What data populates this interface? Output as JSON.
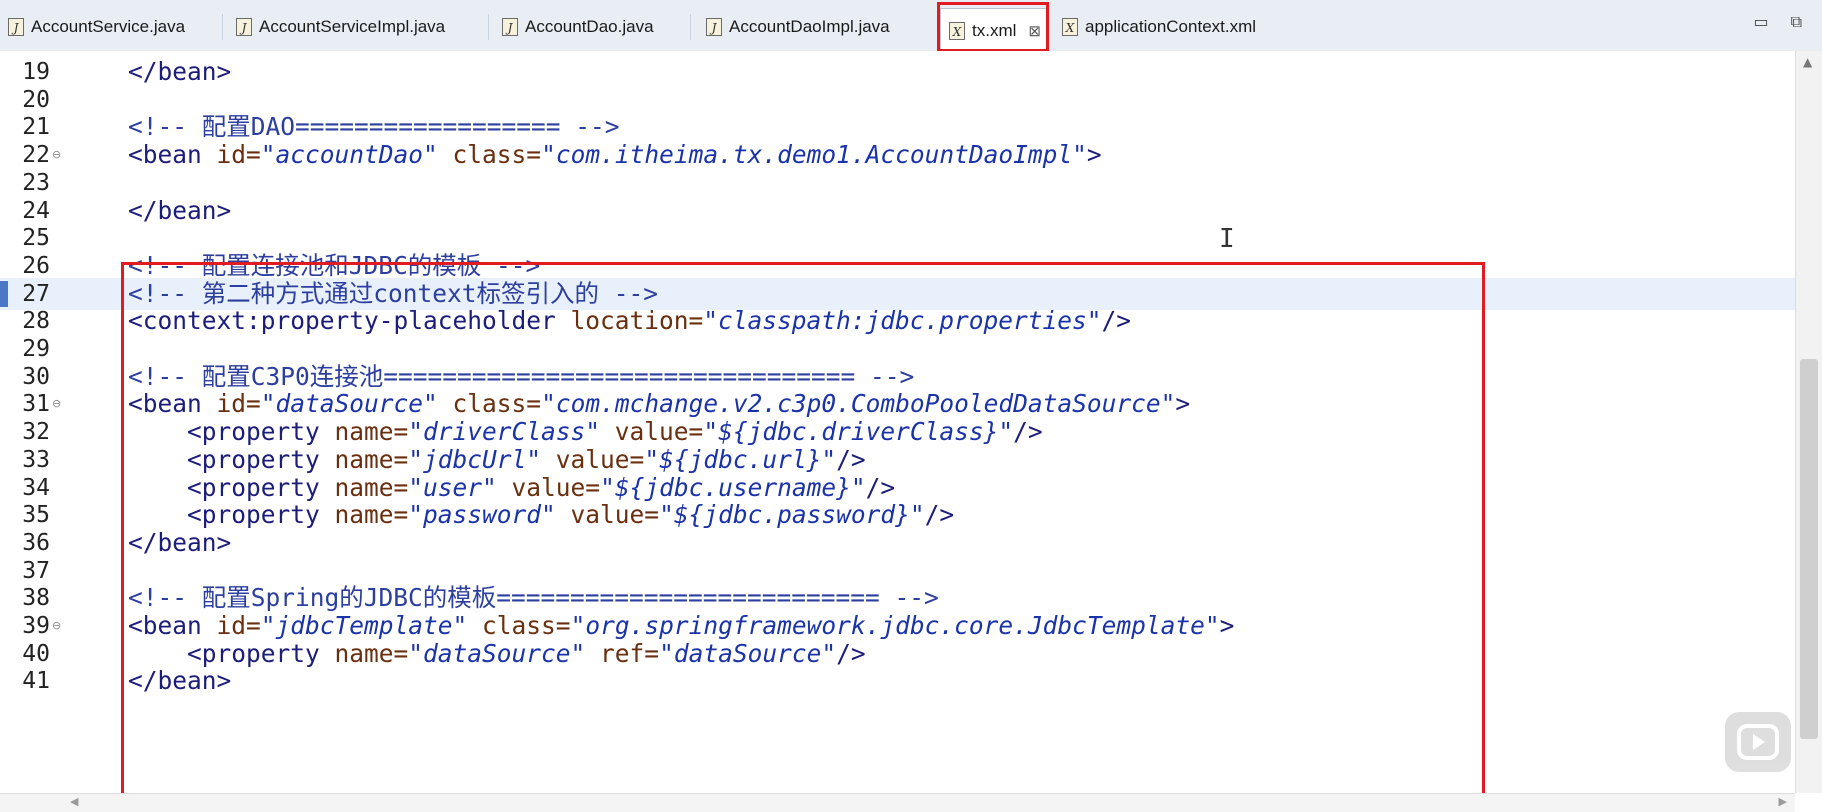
{
  "tabs": [
    {
      "label": "AccountService.java",
      "icon": "java-file-icon"
    },
    {
      "label": "AccountServiceImpl.java",
      "icon": "java-file-icon"
    },
    {
      "label": "AccountDao.java",
      "icon": "java-file-icon"
    },
    {
      "label": "AccountDaoImpl.java",
      "icon": "java-file-icon"
    },
    {
      "label": "tx.xml",
      "icon": "xml-file-icon",
      "active": true
    },
    {
      "label": "applicationContext.xml",
      "icon": "xml-file-icon"
    }
  ],
  "tab_close_glyph": "⊠",
  "window_controls": {
    "minimize": "▭",
    "maximize": "⧉"
  },
  "editor": {
    "current_line": 27,
    "lines": [
      {
        "n": "19",
        "parts": [
          [
            "tag",
            "</bean>"
          ]
        ]
      },
      {
        "n": "20",
        "parts": []
      },
      {
        "n": "21",
        "parts": [
          [
            "cmt",
            "<!-- 配置DAO================== -->"
          ]
        ]
      },
      {
        "n": "22",
        "fold": true,
        "parts": [
          [
            "tag",
            "<bean "
          ],
          [
            "attr",
            "id="
          ],
          [
            "str",
            "\"accountDao\""
          ],
          [
            "attr",
            " class="
          ],
          [
            "str",
            "\"com.itheima.tx.demo1.AccountDaoImpl\""
          ],
          [
            "tag",
            ">"
          ]
        ]
      },
      {
        "n": "23",
        "parts": []
      },
      {
        "n": "24",
        "parts": [
          [
            "tag",
            "</bean>"
          ]
        ]
      },
      {
        "n": "25",
        "parts": []
      },
      {
        "n": "26",
        "parts": [
          [
            "cmt",
            "<!-- 配置连接池和JDBC的模板 -->"
          ]
        ]
      },
      {
        "n": "27",
        "parts": [
          [
            "cmt",
            "<!-- 第二种方式通过context标签引入的 -->"
          ]
        ]
      },
      {
        "n": "28",
        "parts": [
          [
            "tag",
            "<context:property-placeholder "
          ],
          [
            "attr",
            "location="
          ],
          [
            "str",
            "\"classpath:jdbc.properties\""
          ],
          [
            "tag",
            "/>"
          ]
        ]
      },
      {
        "n": "29",
        "parts": []
      },
      {
        "n": "30",
        "parts": [
          [
            "cmt",
            "<!-- 配置C3P0连接池================================ -->"
          ]
        ]
      },
      {
        "n": "31",
        "fold": true,
        "parts": [
          [
            "tag",
            "<bean "
          ],
          [
            "attr",
            "id="
          ],
          [
            "str",
            "\"dataSource\""
          ],
          [
            "attr",
            " class="
          ],
          [
            "str",
            "\"com.mchange.v2.c3p0.ComboPooledDataSource\""
          ],
          [
            "tag",
            ">"
          ]
        ]
      },
      {
        "n": "32",
        "parts": [
          [
            "tag",
            "    <property "
          ],
          [
            "attr",
            "name="
          ],
          [
            "str",
            "\"driverClass\""
          ],
          [
            "attr",
            " value="
          ],
          [
            "str",
            "\"${jdbc.driverClass}\""
          ],
          [
            "tag",
            "/>"
          ]
        ]
      },
      {
        "n": "33",
        "parts": [
          [
            "tag",
            "    <property "
          ],
          [
            "attr",
            "name="
          ],
          [
            "str",
            "\"jdbcUrl\""
          ],
          [
            "attr",
            " value="
          ],
          [
            "str",
            "\"${jdbc.url}\""
          ],
          [
            "tag",
            "/>"
          ]
        ]
      },
      {
        "n": "34",
        "parts": [
          [
            "tag",
            "    <property "
          ],
          [
            "attr",
            "name="
          ],
          [
            "str",
            "\"user\""
          ],
          [
            "attr",
            " value="
          ],
          [
            "str",
            "\"${jdbc.username}\""
          ],
          [
            "tag",
            "/>"
          ]
        ]
      },
      {
        "n": "35",
        "parts": [
          [
            "tag",
            "    <property "
          ],
          [
            "attr",
            "name="
          ],
          [
            "str",
            "\"password\""
          ],
          [
            "attr",
            " value="
          ],
          [
            "str",
            "\"${jdbc.password}\""
          ],
          [
            "tag",
            "/>"
          ]
        ]
      },
      {
        "n": "36",
        "parts": [
          [
            "tag",
            "</bean>"
          ]
        ]
      },
      {
        "n": "37",
        "parts": []
      },
      {
        "n": "38",
        "parts": [
          [
            "cmt",
            "<!-- 配置Spring的JDBC的模板========================== -->"
          ]
        ]
      },
      {
        "n": "39",
        "fold": true,
        "parts": [
          [
            "tag",
            "<bean "
          ],
          [
            "attr",
            "id="
          ],
          [
            "str",
            "\"jdbcTemplate\""
          ],
          [
            "attr",
            " class="
          ],
          [
            "str",
            "\"org.springframework.jdbc.core.JdbcTemplate\""
          ],
          [
            "tag",
            ">"
          ]
        ]
      },
      {
        "n": "40",
        "parts": [
          [
            "tag",
            "    <property "
          ],
          [
            "attr",
            "name="
          ],
          [
            "str",
            "\"dataSource\""
          ],
          [
            "attr",
            " ref="
          ],
          [
            "str",
            "\"dataSource\""
          ],
          [
            "tag",
            "/>"
          ]
        ]
      },
      {
        "n": "41",
        "parts": [
          [
            "tag",
            "</bean>"
          ]
        ]
      }
    ]
  },
  "colors": {
    "highlight_box": "#e11b22",
    "current_line_bg": "#e8f0fb"
  }
}
